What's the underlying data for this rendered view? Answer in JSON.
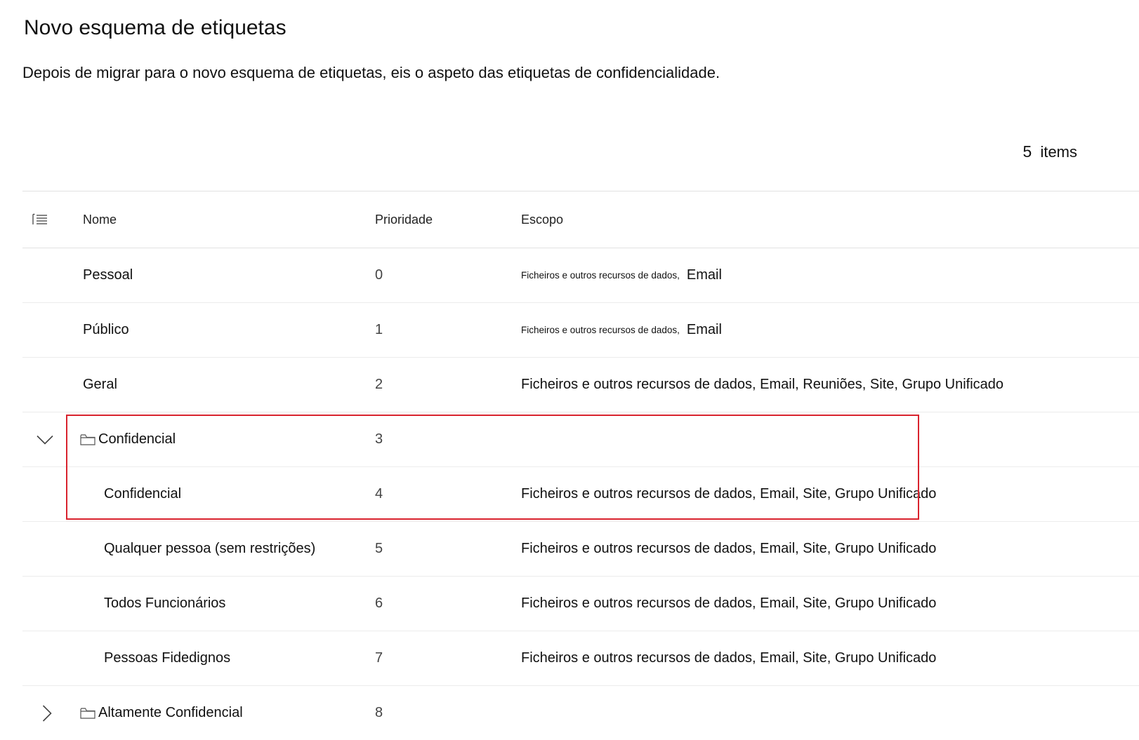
{
  "page": {
    "title": "Novo esquema de etiquetas",
    "description": "Depois de migrar para o novo esquema de etiquetas, eis o aspeto das etiquetas de confidencialidade.",
    "item_count": "5",
    "item_count_label": "items"
  },
  "table": {
    "columns": {
      "name": "Nome",
      "priority": "Prioridade",
      "scope": "Escopo"
    },
    "rows": [
      {
        "name": "Pessoal",
        "priority": "0",
        "scope_small": "Ficheiros e outros recursos de dados,",
        "scope": "Email"
      },
      {
        "name": "Público",
        "priority": "1",
        "scope_small": "Ficheiros e outros recursos de dados,",
        "scope": "Email"
      },
      {
        "name": "Geral",
        "priority": "2",
        "scope": "Ficheiros e outros recursos de dados, Email, Reuniões, Site, Grupo Unificado"
      },
      {
        "name": "Confidencial",
        "priority": "3",
        "scope": "",
        "expanded": true
      },
      {
        "name": "Confidencial",
        "priority": "4",
        "scope": "Ficheiros e outros recursos de dados, Email, Site, Grupo Unificado"
      },
      {
        "name": "Qualquer pessoa (sem restrições)",
        "priority": "5",
        "scope": "Ficheiros e outros recursos de dados, Email, Site, Grupo Unificado"
      },
      {
        "name": "Todos Funcionários",
        "priority": "6",
        "scope": "Ficheiros e outros recursos de dados, Email, Site, Grupo Unificado"
      },
      {
        "name": "Pessoas Fidedignos",
        "priority": "7",
        "scope": "Ficheiros e outros recursos de dados, Email, Site, Grupo Unificado"
      },
      {
        "name": "Altamente Confidencial",
        "priority": "8",
        "scope": "",
        "expanded": false
      }
    ]
  },
  "colors": {
    "highlight": "#d9232e",
    "divider": "#e1e1e1"
  },
  "icons": {
    "column_options": "list-icon",
    "group": "folder-icon",
    "expanded": "chevron-down-icon",
    "collapsed": "chevron-right-icon"
  }
}
